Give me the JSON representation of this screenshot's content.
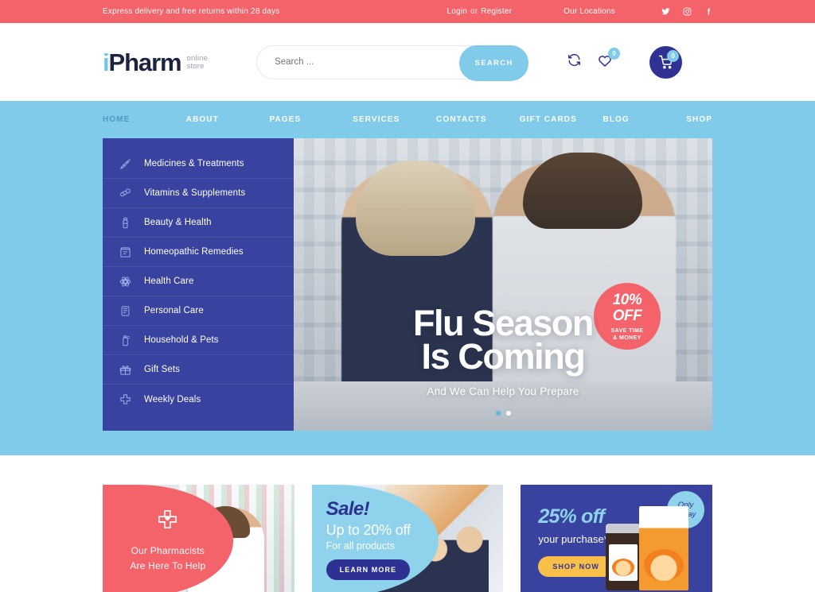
{
  "topbar": {
    "message": "Express delivery and free returns within 28 days",
    "login": "Login",
    "or": "or",
    "register": "Register",
    "locations": "Our Locations",
    "social": [
      {
        "name": "twitter-icon"
      },
      {
        "name": "instagram-icon"
      },
      {
        "name": "facebook-icon"
      }
    ],
    "bg_color": "#F4626A"
  },
  "header": {
    "logo_i": "i",
    "logo_rest": "Pharm",
    "logo_sub_line1": "online",
    "logo_sub_line2": "store",
    "search": {
      "placeholder": "Search ...",
      "value": "",
      "button_label": "SEARCH"
    },
    "compare_count": "",
    "wishlist_count": "0",
    "cart_count": "0",
    "accent_color": "#7FCBE9",
    "navy_color": "#2F3293"
  },
  "nav": {
    "items": [
      {
        "label": "HOME",
        "active": true
      },
      {
        "label": "ABOUT",
        "active": false
      },
      {
        "label": "PAGES",
        "active": false
      },
      {
        "label": "SERVICES",
        "active": false
      },
      {
        "label": "CONTACTS",
        "active": false
      },
      {
        "label": "GIFT CARDS",
        "active": false
      },
      {
        "label": "BLOG",
        "active": false
      },
      {
        "label": "SHOP",
        "active": false
      }
    ]
  },
  "categories": {
    "items": [
      {
        "label": "Medicines & Treatments",
        "icon": "syringe-icon"
      },
      {
        "label": "Vitamins & Supplements",
        "icon": "capsule-icon"
      },
      {
        "label": "Beauty & Health",
        "icon": "bottle-icon"
      },
      {
        "label": "Homeopathic Remedies",
        "icon": "remedy-box-icon"
      },
      {
        "label": "Health Care",
        "icon": "molecule-icon"
      },
      {
        "label": "Personal Care",
        "icon": "personal-care-icon"
      },
      {
        "label": "Household & Pets",
        "icon": "spray-bottle-icon"
      },
      {
        "label": "Gift Sets",
        "icon": "gift-icon"
      },
      {
        "label": "Weekly Deals",
        "icon": "cross-deals-icon"
      }
    ]
  },
  "hero": {
    "title_line1": "Flu Season",
    "title_line2": "Is Coming",
    "subtitle": "And We Can Help You Prepare",
    "badge": {
      "percent": "10%",
      "off": "OFF",
      "line1": "SAVE TIME",
      "line2": "& MONEY",
      "color": "#F4626A"
    },
    "prev_arrow": "‹",
    "next_arrow": "›",
    "slides_total": 2,
    "active_slide": 1
  },
  "promos": [
    {
      "icon": "pharmacy-cross-heart-icon",
      "line1": "Our Pharmacists",
      "line2": "Are Here To Help",
      "bg_color": "#F4626A"
    },
    {
      "title": "Sale!",
      "line1": "Up to 20% off",
      "line2": "For all products",
      "button_label": "LEARN MORE",
      "bg_color": "#8ED2EC"
    },
    {
      "title": "25% off",
      "line1": "your purchase*",
      "button_label": "SHOP NOW",
      "badge_line1": "Only",
      "badge_line2": "Today",
      "bg_color": "#39429E"
    }
  ]
}
